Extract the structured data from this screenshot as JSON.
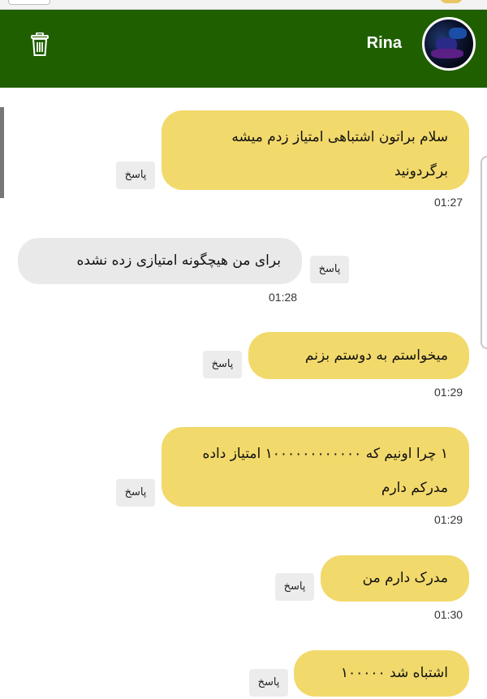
{
  "header": {
    "contact_name": "Rina"
  },
  "messages": [
    {
      "text": "سلام براتون اشتباهی امتیاز زدم میشه برگردونید",
      "time": "01:27",
      "reply_label": "پاسخ",
      "sender": "me"
    },
    {
      "text": "برای من هیچگونه امتیازی زده نشده",
      "time": "01:28",
      "reply_label": "پاسخ",
      "sender": "other"
    },
    {
      "text": "میخواستم به دوستم بزنم",
      "time": "01:29",
      "reply_label": "پاسخ",
      "sender": "me"
    },
    {
      "text": "۱ چرا اونیم که ۱۰۰۰۰۰۰۰۰۰۰۰۰ امتیاز داده مدرکم دارم",
      "time": "01:29",
      "reply_label": "پاسخ",
      "sender": "me"
    },
    {
      "text": "مدرک دارم من",
      "time": "01:30",
      "reply_label": "پاسخ",
      "sender": "me"
    },
    {
      "text": "اشتباه شد ۱۰۰۰۰۰",
      "time": "",
      "reply_label": "پاسخ",
      "sender": "me"
    }
  ],
  "colors": {
    "header": "#1f5f00",
    "my_bubble": "#f2d96b",
    "their_bubble": "#e9e9e9"
  },
  "icons": {
    "delete": "trash-icon",
    "avatar": "contact-avatar"
  }
}
